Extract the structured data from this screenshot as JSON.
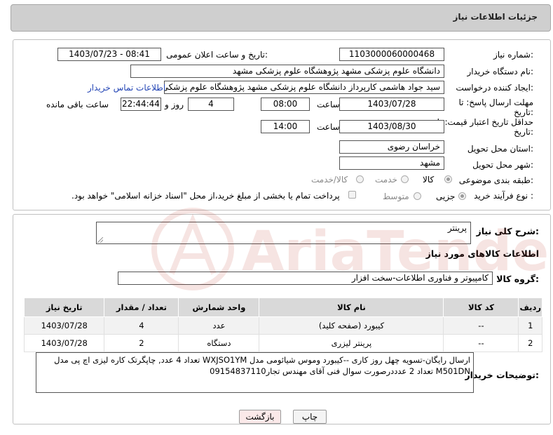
{
  "header": {
    "title": "جزئیات اطلاعات نیاز"
  },
  "form": {
    "need_number": {
      "label": "شماره نیاز:",
      "value": "1103000060000468"
    },
    "announce_datetime": {
      "label": "تاریخ و ساعت اعلان عمومی:",
      "value": "1403/07/23 - 08:41"
    },
    "buyer_org": {
      "label": "نام دستگاه خریدار:",
      "value": "دانشگاه علوم پزشکی مشهد   پژوهشگاه علوم پزشکی مشهد"
    },
    "requester": {
      "label": "ایجاد کننده درخواست:",
      "value": "سید جواد هاشمی کارپرداز دانشگاه علوم پزشکی مشهد   پژوهشگاه علوم پزشکی مشهد",
      "contact_link": "اطلاعات تماس خریدار"
    },
    "reply_deadline": {
      "label_line1": "مهلت ارسال پاسخ: تا",
      "label_line2": "تاریخ:",
      "date": "1403/07/28",
      "time_label": "ساعت",
      "time": "08:00",
      "days": "4",
      "days_label": "روز و",
      "remaining": "22:44:44",
      "remaining_label": "ساعت باقی مانده"
    },
    "price_validity": {
      "label_line1": "حداقل تاریخ اعتبار قیمت: تا",
      "label_line2": "تاریخ:",
      "date": "1403/08/30",
      "time_label": "ساعت",
      "time": "14:00"
    },
    "delivery_province": {
      "label": "استان محل تحویل:",
      "value": "خراسان رضوی"
    },
    "delivery_city": {
      "label": "شهر محل تحویل:",
      "value": "مشهد"
    },
    "category": {
      "label": "طبقه بندی موضوعی:",
      "options": [
        "کالا",
        "خدمت",
        "کالا/خدمت"
      ],
      "selected": "کالا"
    },
    "purchase_type": {
      "label": "نوع فرآیند خرید :",
      "options": [
        "جزیی",
        "متوسط"
      ],
      "selected": "جزیی",
      "note": "پرداخت تمام یا بخشی از مبلغ خرید،از محل \"اسناد خزانه اسلامی\" خواهد بود."
    }
  },
  "summary": {
    "general_desc_label": "شرح کلی نیاز:",
    "general_desc_value": "پرینتر",
    "goods_info_title": "اطلاعات کالاهای مورد نیاز",
    "goods_group_label": "گروه کالا:",
    "goods_group_value": "کامپیوتر و فناوری اطلاعات-سخت افزار"
  },
  "table": {
    "headers": [
      "ردیف",
      "کد کالا",
      "نام کالا",
      "واحد شمارش",
      "تعداد / مقدار",
      "تاریخ نیاز"
    ],
    "rows": [
      [
        "1",
        "--",
        "کیبورد (صفحه کلید)",
        "عدد",
        "4",
        "1403/07/28"
      ],
      [
        "2",
        "--",
        "پرینتر لیزری",
        "دستگاه",
        "2",
        "1403/07/28"
      ]
    ]
  },
  "buyer_notes": {
    "label": "توضیحات خریدار:",
    "line1": "ارسال رایگان-تسویه چهل روز کاری --کیبورد وموس شیائومی مدل WXJSO1YM تعداد 4 عدد, چاپگرتک کاره لیزی اچ پی مدل",
    "line2": "M501DN  تعداد 2 عدددرصورت سوال فنی آقای مهندس تجار09154837110"
  },
  "buttons": {
    "print": "چاپ",
    "back": "بازگشت"
  },
  "watermark": {
    "text": "AriaTender.net",
    "color": "#c0392b"
  }
}
